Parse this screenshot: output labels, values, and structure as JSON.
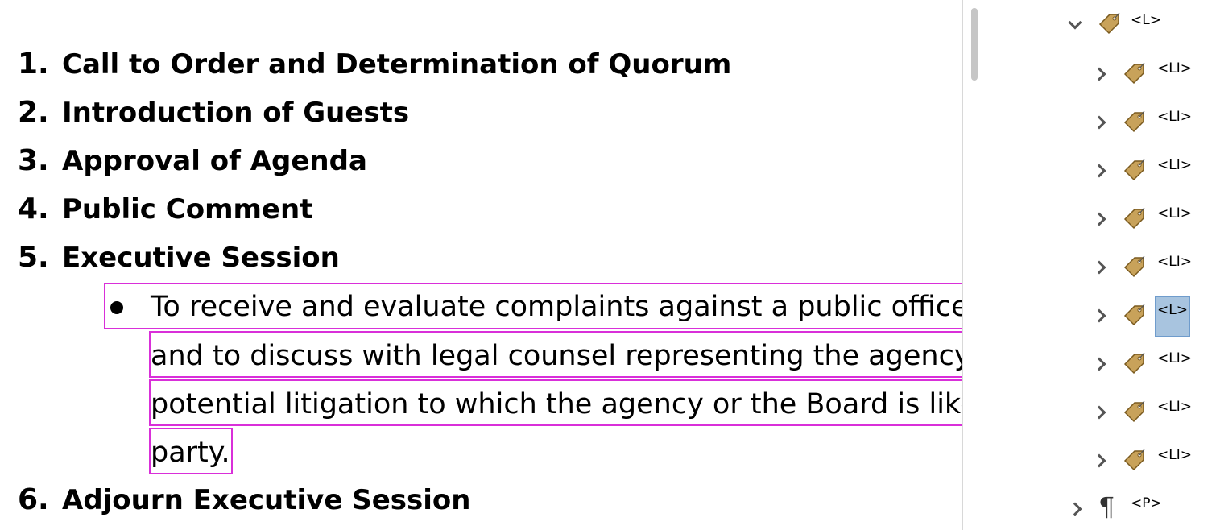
{
  "document": {
    "numbered_items": [
      {
        "number": "1.",
        "text": "Call to Order and Determination of Quorum"
      },
      {
        "number": "2.",
        "text": "Introduction of Guests"
      },
      {
        "number": "3.",
        "text": "Approval of Agenda"
      },
      {
        "number": "4.",
        "text": "Public Comment"
      },
      {
        "number": "5.",
        "text": "Executive Session"
      },
      {
        "number": "6.",
        "text": "Adjourn Executive Session"
      }
    ],
    "bullet_lines": [
      "To receive and evaluate complaints against a public officer",
      "and to discuss with legal counsel representing the agency",
      "potential litigation to which the agency or the Board is like",
      "party."
    ]
  },
  "tags_panel": {
    "root": {
      "label": "<L>",
      "expanded": true
    },
    "children": [
      {
        "label": "<LI>",
        "selected": false
      },
      {
        "label": "<LI>",
        "selected": false
      },
      {
        "label": "<LI>",
        "selected": false
      },
      {
        "label": "<LI>",
        "selected": false
      },
      {
        "label": "<LI>",
        "selected": false
      },
      {
        "label": "<L>",
        "selected": true
      },
      {
        "label": "<LI>",
        "selected": false
      },
      {
        "label": "<LI>",
        "selected": false
      },
      {
        "label": "<LI>",
        "selected": false
      }
    ],
    "sibling": {
      "label": "<P>",
      "icon": "paragraph-icon"
    },
    "colors": {
      "tag_icon": "#c8a25a",
      "selection": "#a8c4df",
      "highlight_border": "#d92fd9"
    }
  }
}
